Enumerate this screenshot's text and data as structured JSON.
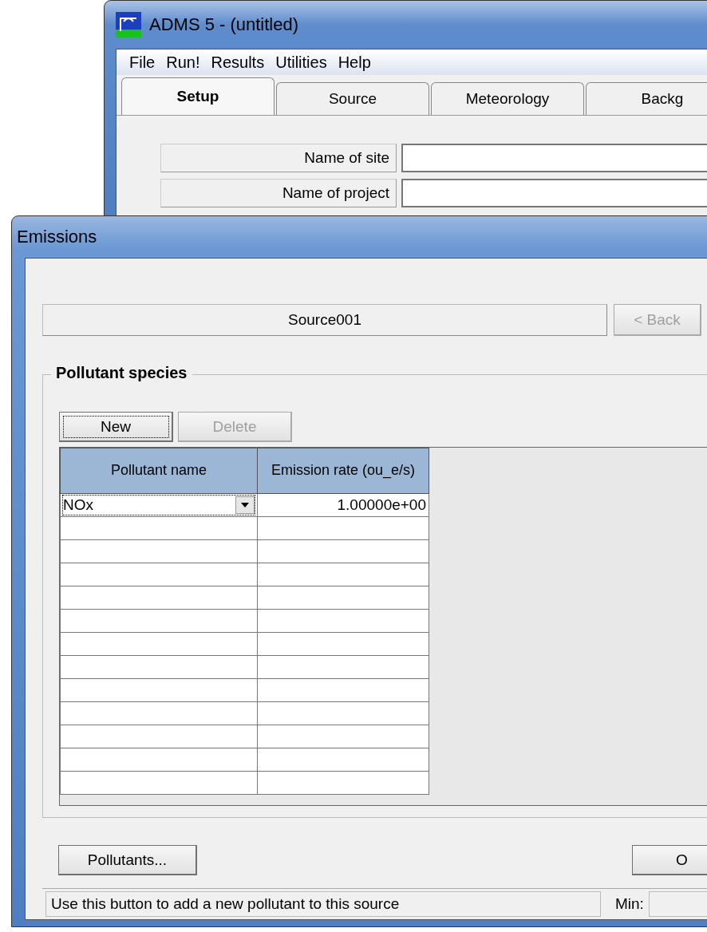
{
  "main_window": {
    "title": "ADMS 5 - (untitled)",
    "menu": [
      "File",
      "Run!",
      "Results",
      "Utilities",
      "Help"
    ],
    "tabs": [
      {
        "label": "Setup",
        "selected": true
      },
      {
        "label": "Source",
        "selected": false
      },
      {
        "label": "Meteorology",
        "selected": false
      },
      {
        "label": "Backg",
        "selected": false
      }
    ],
    "fields": [
      {
        "label": "Name of site"
      },
      {
        "label": "Name of project"
      }
    ]
  },
  "dialog": {
    "title": "Emissions",
    "source_name": "Source001",
    "back_button": {
      "label": "< Back",
      "disabled": true
    },
    "group": {
      "title": "Pollutant species",
      "buttons": [
        {
          "label": "New",
          "disabled": false,
          "focused": true
        },
        {
          "label": "Delete",
          "disabled": true,
          "focused": false
        }
      ],
      "table": {
        "columns": [
          "Pollutant name",
          "Emission rate (ou_e/s)"
        ],
        "rows": [
          {
            "pollutant": "NOx",
            "rate": "1.00000e+00"
          }
        ]
      }
    },
    "pollutants_button": "Pollutants...",
    "right_button": "O",
    "status_bar": {
      "message": "Use this button to add a new pollutant to this source",
      "min_label": "Min:"
    }
  }
}
